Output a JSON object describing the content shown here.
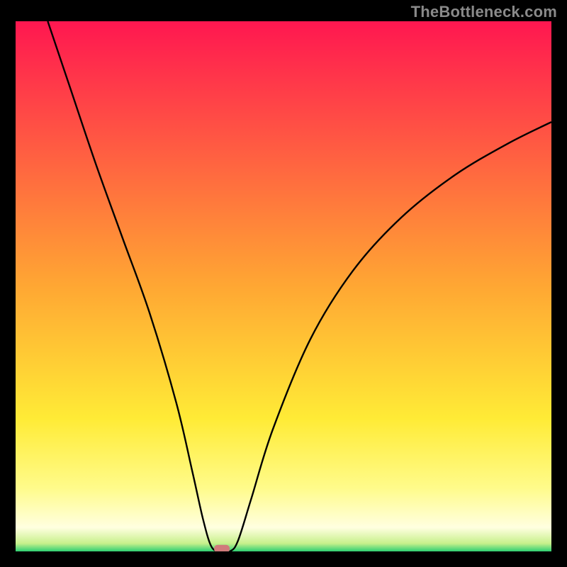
{
  "watermark": "TheBottleneck.com",
  "chart_data": {
    "type": "line",
    "title": "",
    "xlabel": "",
    "ylabel": "",
    "xlim": [
      0,
      100
    ],
    "ylim": [
      0,
      100
    ],
    "grid": false,
    "legend": false,
    "background": {
      "kind": "linear-gradient",
      "direction": "vertical",
      "stops": [
        {
          "pos": 0,
          "color": "#ff1750"
        },
        {
          "pos": 0.5,
          "color": "#ffa733"
        },
        {
          "pos": 0.75,
          "color": "#ffeb36"
        },
        {
          "pos": 0.88,
          "color": "#fffb8a"
        },
        {
          "pos": 0.955,
          "color": "#ffffe0"
        },
        {
          "pos": 0.985,
          "color": "#c7f08b"
        },
        {
          "pos": 1.0,
          "color": "#2ecf73"
        }
      ]
    },
    "curve": {
      "description": "V-shaped bottleneck-percentage curve",
      "minimum_x": 38,
      "minimum_y": 0,
      "points": [
        {
          "x": 6,
          "y": 100
        },
        {
          "x": 10,
          "y": 88
        },
        {
          "x": 15,
          "y": 73
        },
        {
          "x": 20,
          "y": 59
        },
        {
          "x": 25,
          "y": 45
        },
        {
          "x": 30,
          "y": 28
        },
        {
          "x": 33,
          "y": 15
        },
        {
          "x": 35,
          "y": 6
        },
        {
          "x": 36.5,
          "y": 1
        },
        {
          "x": 38,
          "y": 0
        },
        {
          "x": 40,
          "y": 0
        },
        {
          "x": 41.5,
          "y": 2
        },
        {
          "x": 44,
          "y": 10
        },
        {
          "x": 48,
          "y": 23
        },
        {
          "x": 55,
          "y": 40
        },
        {
          "x": 63,
          "y": 53
        },
        {
          "x": 72,
          "y": 63
        },
        {
          "x": 82,
          "y": 71
        },
        {
          "x": 92,
          "y": 77
        },
        {
          "x": 100,
          "y": 81
        }
      ]
    },
    "marker": {
      "x": 38.5,
      "y": 0.5,
      "color": "#d07b7b",
      "shape": "rounded-rect"
    }
  }
}
